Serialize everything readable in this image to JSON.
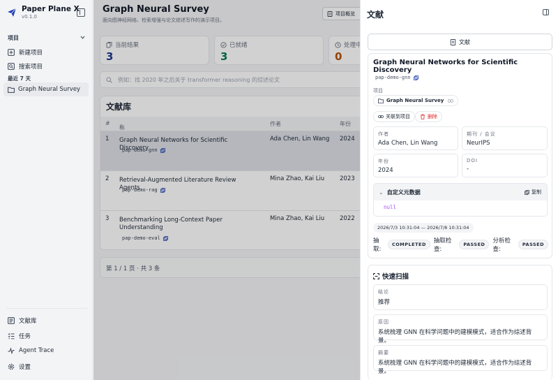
{
  "app": {
    "title": "Paper Plane X",
    "version": "v0.1.0"
  },
  "sidebar": {
    "projects_label": "项目",
    "new_project": "新建项目",
    "search_projects": "搜索项目",
    "recent_label": "最近 7 天",
    "recent_items": [
      "Graph Neural Survey"
    ],
    "bottom": [
      "文献库",
      "任务",
      "Agent Trace",
      "设置"
    ]
  },
  "main": {
    "title": "Graph Neural Survey",
    "subtitle": "面向图神经网络、检索增强与论文综述写作的演示项目。",
    "overview_button": "项目概览",
    "stats": [
      {
        "label": "当前结果",
        "value": "3",
        "color": "#1e3a8a"
      },
      {
        "label": "已就绪",
        "value": "3",
        "color": "#047857"
      },
      {
        "label": "处理中",
        "value": "0",
        "color": "#b45309"
      }
    ],
    "search_placeholder": "例如：找 2020 年之后关于 transformer reasoning 的综述论文",
    "library": {
      "title": "文献库",
      "columns": [
        "#",
        "标题",
        "作者",
        "年份"
      ],
      "rows": [
        {
          "no": "1",
          "title": "Graph Neural Networks for Scientific Discovery",
          "id": "pap-demo-gnn",
          "authors": "Ada Chen, Lin Wang",
          "year": "2024"
        },
        {
          "no": "2",
          "title": "Retrieval-Augmented Literature Review Agents",
          "id": "pap-demo-rag",
          "authors": "Mina Zhao, Kai Liu",
          "year": "2023"
        },
        {
          "no": "3",
          "title": "Benchmarking Long-Context Paper Understanding",
          "id": "pap-demo-eval",
          "authors": "Mina Zhao, Kai Liu",
          "year": "2022"
        }
      ]
    },
    "pager": "第 1 / 1 页 · 共 3 条"
  },
  "drawer": {
    "title": "文献",
    "doc_button": "文献",
    "paper_title": "Graph Neural Networks for Scientific Discovery",
    "paper_id": "pap-demo-gnn",
    "project_label": "项目",
    "project_name": "Graph Neural Survey",
    "link_button": "关联到项目",
    "delete_button": "删除",
    "fields": {
      "authors_label": "作者",
      "authors": "Ada Chen, Lin Wang",
      "venue_label": "期刊 / 会议",
      "venue": "NeurIPS",
      "year_label": "年份",
      "year": "2024",
      "doi_label": "DOI",
      "doi": "-"
    },
    "meta": {
      "title": "自定义元数据",
      "copy": "复制",
      "value": "null"
    },
    "date_range": "2026/7/3 10:31:04 — 2026/7/8 10:31:04",
    "status": {
      "extract_label": "抽取:",
      "extract": "COMPLETED",
      "extract_check_label": "抽取检查:",
      "extract_check": "PASSED",
      "analysis_check_label": "分析检查:",
      "analysis_check": "PASSED"
    },
    "scan": {
      "title": "快速扫描",
      "conclusion_label": "结论",
      "conclusion": "推荐",
      "reason_label": "原因",
      "reason": "系统梳理 GNN 在科学问题中的建模模式，适合作为综述背景。",
      "summary_label": "摘要",
      "summary": "系统梳理 GNN 在科学问题中的建模模式，适合作为综述背景。"
    }
  }
}
